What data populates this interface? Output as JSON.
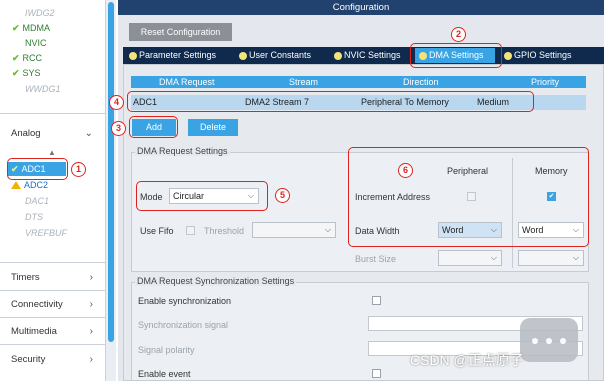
{
  "sidebar": {
    "top_items": [
      {
        "label": "IWDG2",
        "state": "dim"
      },
      {
        "label": "MDMA",
        "state": "ok"
      },
      {
        "label": "NVIC",
        "state": "plain"
      },
      {
        "label": "RCC",
        "state": "ok"
      },
      {
        "label": "SYS",
        "state": "ok"
      },
      {
        "label": "WWDG1",
        "state": "dim"
      }
    ],
    "analog_label": "Analog",
    "analog_items": [
      {
        "label": "ADC1",
        "state": "selected"
      },
      {
        "label": "ADC2",
        "state": "warn"
      },
      {
        "label": "DAC1",
        "state": "dim"
      },
      {
        "label": "DTS",
        "state": "dim"
      },
      {
        "label": "VREFBUF",
        "state": "dim"
      }
    ],
    "categories": [
      "Timers",
      "Connectivity",
      "Multimedia",
      "Security"
    ]
  },
  "config": {
    "title": "Configuration",
    "reset_label": "Reset Configuration",
    "tabs": [
      "Parameter Settings",
      "User Constants",
      "NVIC Settings",
      "DMA Settings",
      "GPIO Settings"
    ],
    "active_tab": "DMA Settings"
  },
  "dma_table": {
    "headers": [
      "DMA Request",
      "Stream",
      "Direction",
      "Priority"
    ],
    "rows": [
      {
        "request": "ADC1",
        "stream": "DMA2 Stream 7",
        "direction": "Peripheral To Memory",
        "priority": "Medium"
      }
    ],
    "add_label": "Add",
    "delete_label": "Delete"
  },
  "request_settings": {
    "title": "DMA Request Settings",
    "mode_label": "Mode",
    "mode_value": "Circular",
    "use_fifo_label": "Use Fifo",
    "threshold_label": "Threshold",
    "threshold_value": "",
    "peripheral_header": "Peripheral",
    "memory_header": "Memory",
    "increment_label": "Increment Address",
    "peripheral_increment": false,
    "memory_increment": true,
    "data_width_label": "Data Width",
    "peripheral_width": "Word",
    "memory_width": "Word",
    "burst_label": "Burst Size"
  },
  "sync_settings": {
    "title": "DMA Request Synchronization Settings",
    "enable_sync_label": "Enable synchronization",
    "sync_signal_label": "Synchronization signal",
    "signal_polarity_label": "Signal polarity",
    "enable_event_label": "Enable event"
  },
  "annotations": [
    "1",
    "2",
    "3",
    "4",
    "5",
    "6"
  ],
  "watermark": "CSDN @正点原子",
  "colors": {
    "accent": "#3aa3e3",
    "header": "#21426e",
    "annotation": "#e0221f",
    "ok": "#6bbd2a",
    "warn": "#f0b400"
  }
}
